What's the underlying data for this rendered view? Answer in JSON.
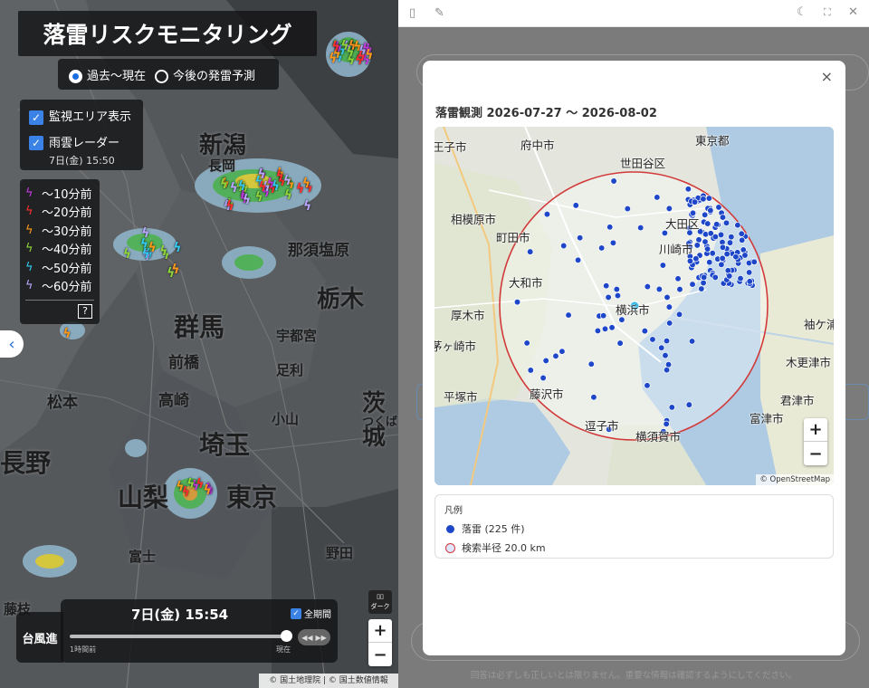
{
  "left_map": {
    "title": "落雷リスクモニタリング",
    "modes": [
      {
        "label": "過去〜現在",
        "selected": true
      },
      {
        "label": "今後の発雷予測",
        "selected": false
      }
    ],
    "layers": [
      {
        "label": "監視エリア表示",
        "checked": true
      },
      {
        "label": "雨雲レーダー",
        "checked": true
      }
    ],
    "radar_time": "7日(金) 15:50",
    "legend": [
      {
        "label": "〜10分前",
        "color": "#c43be0"
      },
      {
        "label": "〜20分前",
        "color": "#ff3030"
      },
      {
        "label": "〜30分前",
        "color": "#ff9a1a"
      },
      {
        "label": "〜40分前",
        "color": "#8fd63a"
      },
      {
        "label": "〜50分前",
        "color": "#35c8f0"
      },
      {
        "label": "〜60分前",
        "color": "#b9a6ff"
      }
    ],
    "help": "?",
    "place_labels": [
      "新潟",
      "長岡",
      "群馬",
      "前橋",
      "高崎",
      "埼玉",
      "山梨",
      "東京",
      "栃木",
      "那須塩原",
      "宇都宮",
      "足利",
      "茨城",
      "つくば",
      "長野",
      "松本",
      "富士",
      "藤枝",
      "野田",
      "小山"
    ],
    "time_label": "7日(金) 15:54",
    "full_period": "全期間",
    "slider_start": "1時間前",
    "slider_end": "現在",
    "typhoon": "台風進",
    "dark_label": "ダーク",
    "attribution": "© 国土地理院 | © 国土数値情報",
    "zoom_in": "+",
    "zoom_out": "−"
  },
  "modal": {
    "title": "落雷観測 2026-07-27 〜 2026-08-02",
    "close": "×",
    "map_labels": [
      "町田市",
      "相模原市",
      "大和市",
      "厚木市",
      "藤沢市",
      "平塚市",
      "逗子市",
      "横須賀市",
      "横浜市",
      "川崎市",
      "大田区",
      "世田谷区",
      "府中市",
      "東京都",
      "木更津市",
      "君津市",
      "富津市",
      "袖ケ浦",
      "王子市",
      "茅ヶ崎市"
    ],
    "attribution": "© OpenStreetMap",
    "legend_title": "凡例",
    "legend_items": [
      "落雷 (225 件)",
      "検索半径 20.0 km"
    ],
    "zoom_in": "+",
    "zoom_out": "−"
  },
  "footer": "回答は必ずしも正しいとは限りません。重要な情報は確認するようにしてください。",
  "colors": {
    "strike_dot": "#1d47c8",
    "radius": "#d23a3a",
    "center": "#29b7e8",
    "sea": "#aecbe3"
  }
}
